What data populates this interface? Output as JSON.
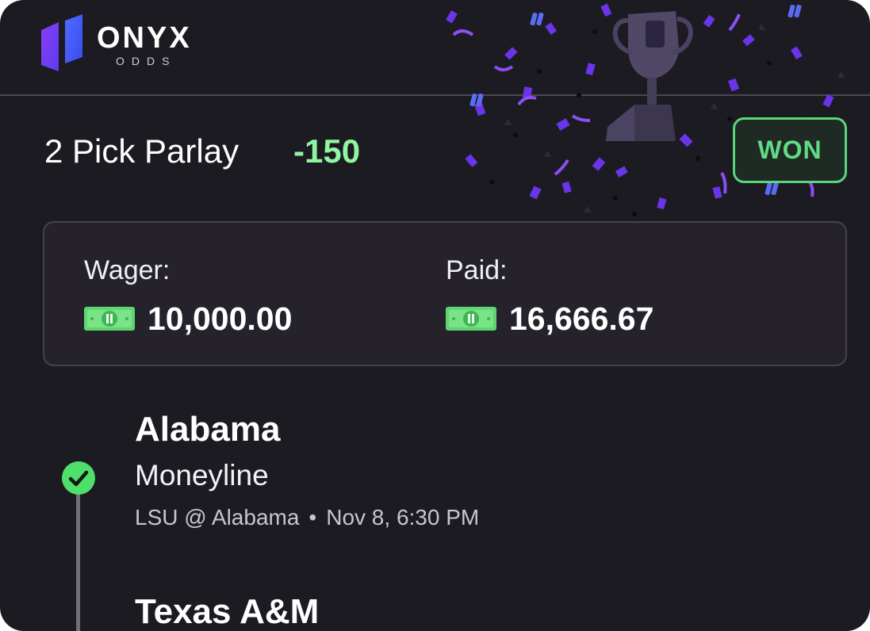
{
  "brand": {
    "name": "ONYX",
    "sub": "ODDS",
    "logo_icon": "onyx-logo-icon"
  },
  "bet": {
    "title": "2 Pick Parlay",
    "odds": "-150",
    "status": "WON",
    "decoration": "trophy-confetti"
  },
  "amounts": {
    "wager_label": "Wager:",
    "wager_value": "10,000.00",
    "paid_label": "Paid:",
    "paid_value": "16,666.67",
    "currency_icon": "cash-bill-icon"
  },
  "legs": [
    {
      "team": "Alabama",
      "market": "Moneyline",
      "matchup": "LSU @ Alabama",
      "separator": "•",
      "datetime": "Nov 8, 6:30 PM",
      "status_icon": "check-circle-icon"
    },
    {
      "team": "Texas A&M"
    }
  ],
  "colors": {
    "background": "#1c1b22",
    "accent_green": "#8ff5a0",
    "won_green": "#5fdc84",
    "confetti_purple": "#7a3ff0"
  }
}
